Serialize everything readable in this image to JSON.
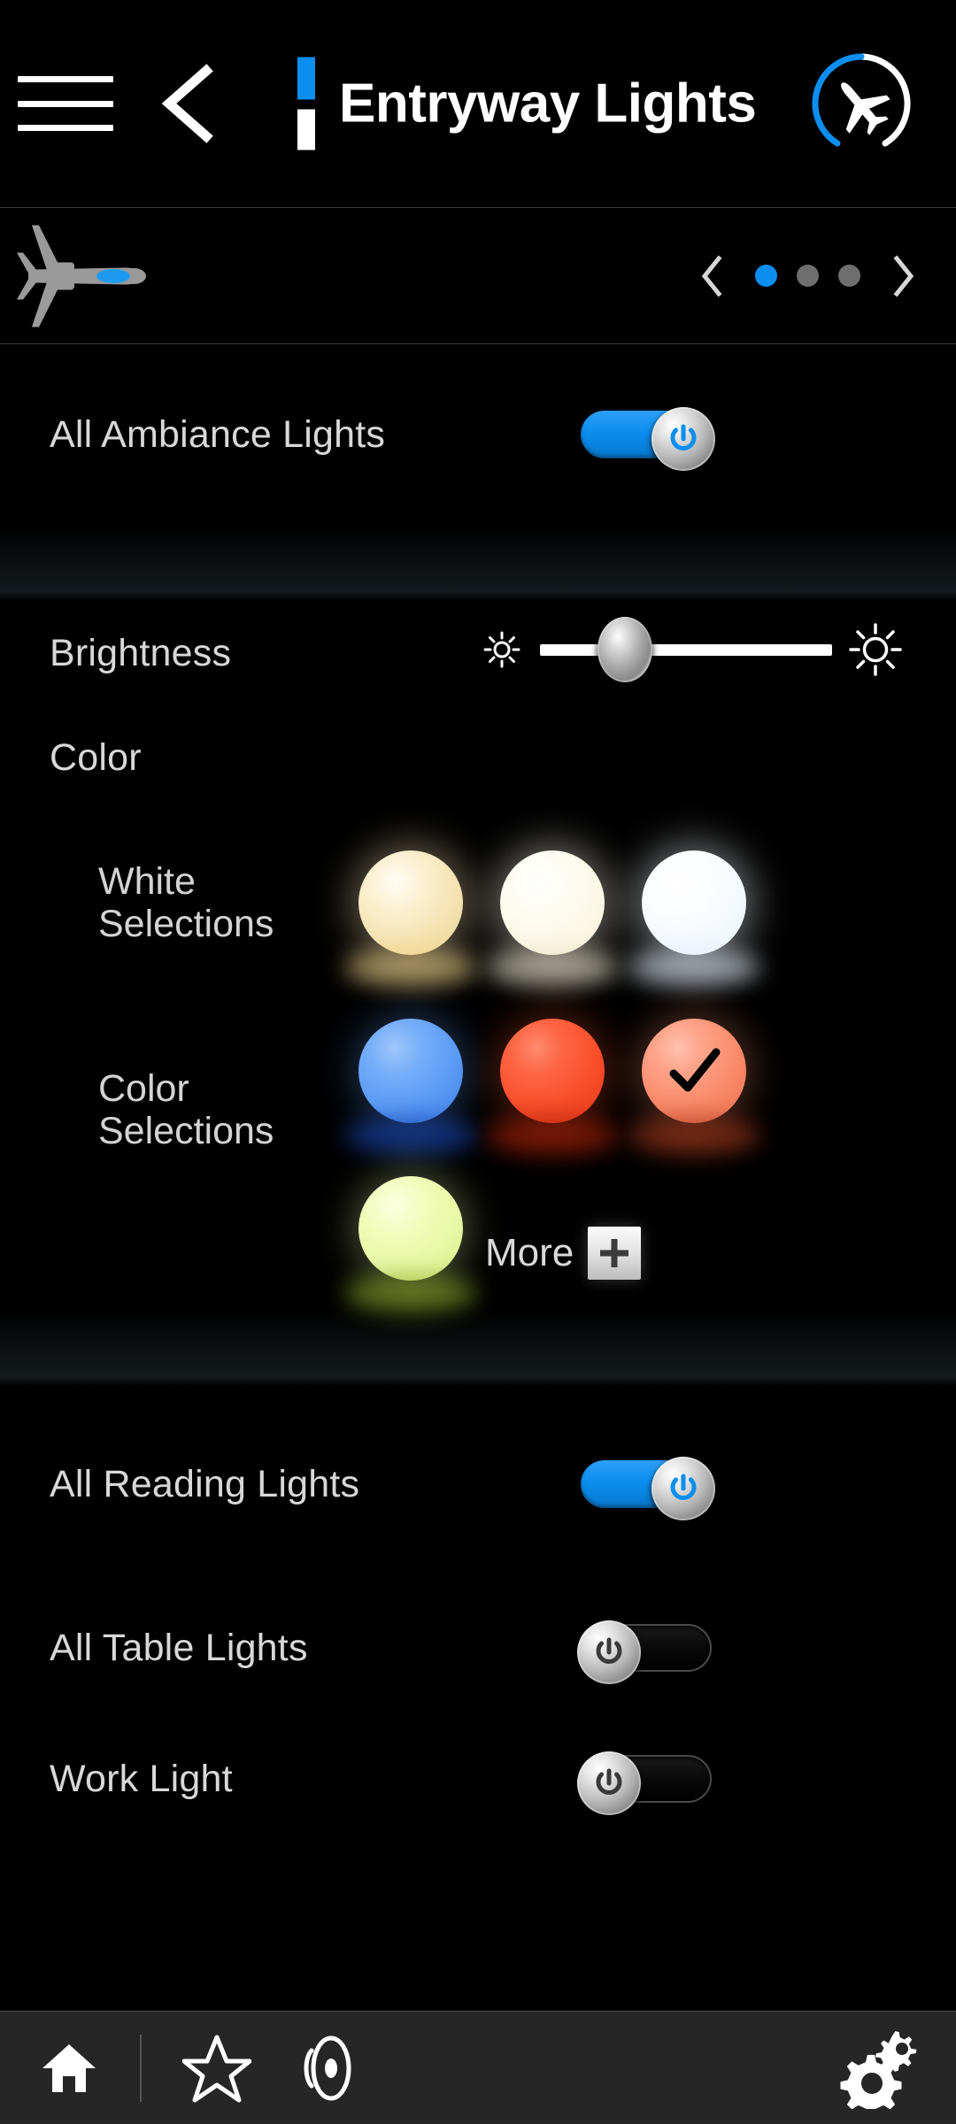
{
  "header": {
    "menu_icon": "hamburger-menu-icon",
    "back_icon": "back-chevron-icon",
    "title": "Entryway Lights",
    "indicator_blue": "#0a8ef0",
    "indicator_white": "#ffffff",
    "badge_icon": "airplane-circle-icon",
    "badge_arc_color": "#0a8ef0"
  },
  "nav_strip": {
    "aircraft_icon": "aircraft-top-view-icon",
    "aircraft_color": "#9a9a9a",
    "zone_highlight_color": "#1d9bf0",
    "prev_label": "‹",
    "next_label": "›",
    "dots": [
      {
        "active": true
      },
      {
        "active": false
      },
      {
        "active": false
      }
    ],
    "active_dot_color": "#0a8ef0",
    "inactive_dot_color": "#6e6e6e"
  },
  "ambiance": {
    "label": "All Ambiance Lights",
    "toggle_state": "on",
    "toggle_on_color": "#0a8ef0"
  },
  "brightness": {
    "label": "Brightness",
    "low_icon": "sun-small-icon",
    "high_icon": "sun-large-icon",
    "value_percent": 29,
    "track_color": "#ffffff"
  },
  "color": {
    "section_label": "Color",
    "white_group_label": "White\nSelections",
    "color_group_label": "Color\nSelections",
    "white_selections": [
      {
        "name": "warm-amber",
        "color": "#f6e2b5",
        "glow": "#f0d38a",
        "selected": false
      },
      {
        "name": "soft-warm-white",
        "color": "#fdf8e6",
        "glow": "#e9e2cb",
        "selected": false
      },
      {
        "name": "cool-white",
        "color": "#f6fbff",
        "glow": "#dfe9f2",
        "selected": false
      }
    ],
    "color_selections": [
      {
        "name": "blue",
        "color": "#5c9cf6",
        "glow": "#1a49b8",
        "selected": false
      },
      {
        "name": "red-orange",
        "color": "#fa4f2c",
        "glow": "#b02208",
        "selected": false
      },
      {
        "name": "coral",
        "color": "#fa8a6b",
        "glow": "#a8391c",
        "selected": true
      },
      {
        "name": "lime-yellow",
        "color": "#e9f8a5",
        "glow": "#8faa2c",
        "selected": false
      }
    ],
    "more_label": "More",
    "more_icon": "plus-icon"
  },
  "reading": {
    "label": "All Reading Lights",
    "toggle_state": "on"
  },
  "table": {
    "label": "All Table Lights",
    "toggle_state": "off"
  },
  "work": {
    "label": "Work Light",
    "toggle_state": "off"
  },
  "bottom_bar": {
    "items": [
      {
        "name": "home-icon",
        "label": "Home"
      },
      {
        "name": "star-icon",
        "label": "Favorites"
      },
      {
        "name": "speaker-icon",
        "label": "Audio"
      },
      {
        "name": "settings-gears-icon",
        "label": "Settings"
      }
    ]
  }
}
